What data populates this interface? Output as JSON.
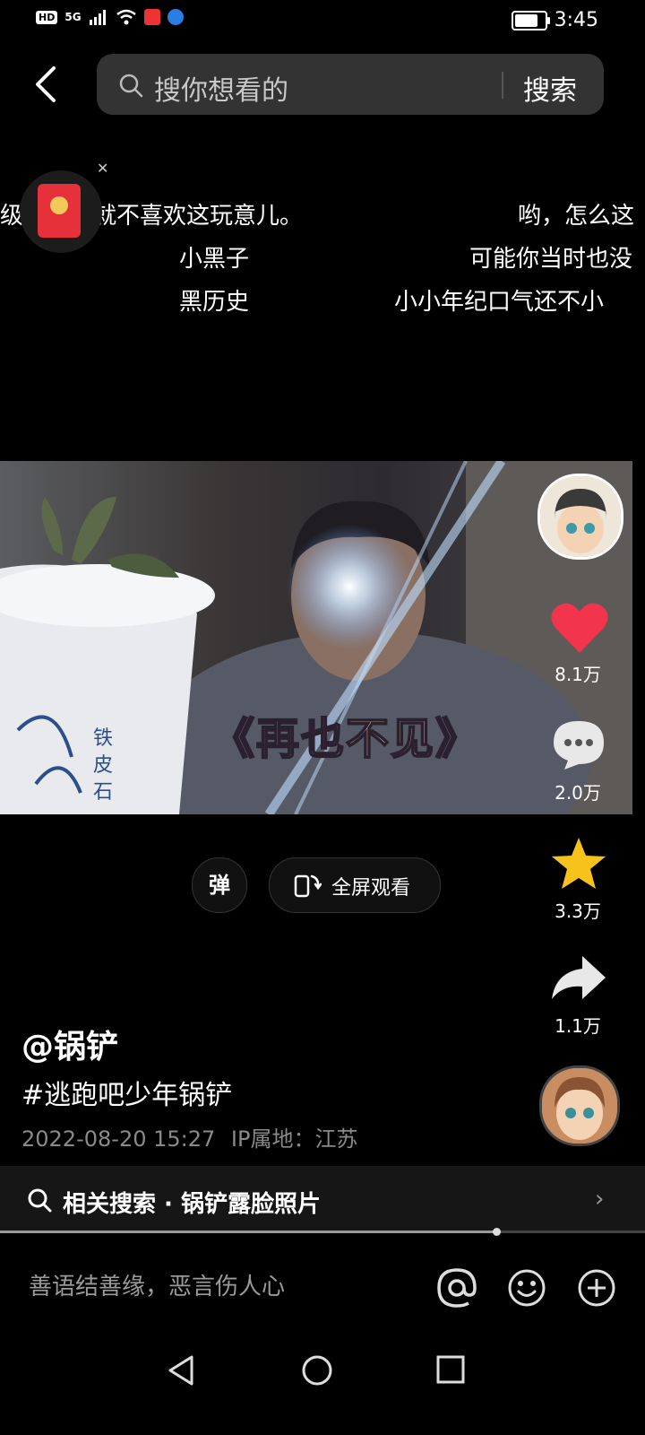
{
  "status_bar": {
    "left_badges": [
      "HD",
      "5G"
    ],
    "time": "3:45",
    "battery_percent": 80
  },
  "header": {
    "search_placeholder": "搜你想看的",
    "search_button": "搜索"
  },
  "danmaku": [
    "级的时候就不喜欢这玩意儿。",
    "哟，怎么这",
    "小黑子",
    "可能你当时也没",
    "黑历史",
    "小小年纪口气还不小"
  ],
  "video": {
    "caption": "《再也不见》",
    "pot_text": "铁皮石斛"
  },
  "rail": {
    "likes": "8.1万",
    "comments": "2.0万",
    "favorites": "3.3万",
    "shares": "1.1万"
  },
  "controls": {
    "danmu_toggle": "弹",
    "fullscreen": "全屏观看"
  },
  "post": {
    "username": "@锅铲",
    "hashtag": "#逃跑吧少年锅铲",
    "date": "2022-08-20 15:27",
    "ip": "IP属地：江苏"
  },
  "related": {
    "label": "相关搜索 · 锅铲露脸照片"
  },
  "progress": 0.77,
  "comment": {
    "placeholder": "善语结善缘，恶言伤人心"
  },
  "icons": [
    "back-icon",
    "search-icon",
    "heart-icon",
    "comment-icon",
    "star-icon",
    "share-icon",
    "at-icon",
    "emoji-icon",
    "add-icon",
    "nav-back-icon",
    "nav-home-icon",
    "nav-recents-icon"
  ],
  "colors": {
    "like": "#f2344d",
    "favorite": "#f7c21a",
    "caption": "#f6e9a6"
  }
}
